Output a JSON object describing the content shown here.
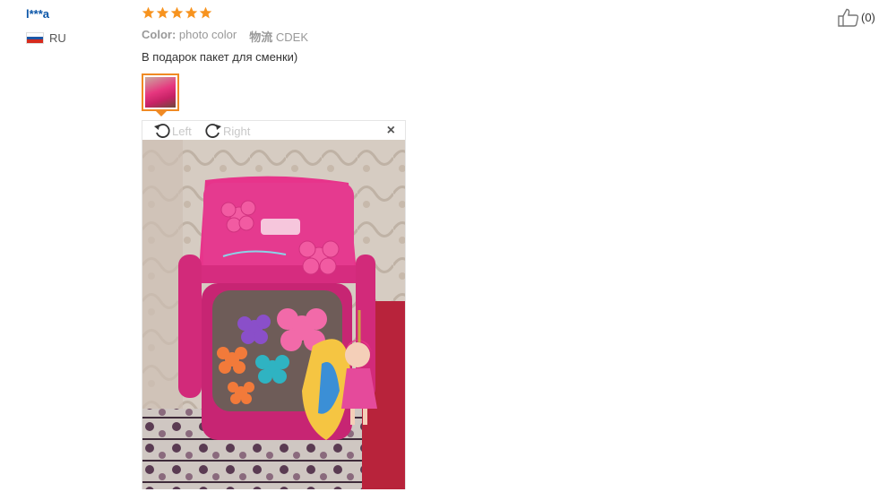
{
  "review": {
    "user_name": "l***a",
    "country": "RU",
    "rating": 5,
    "color_label": "Color:",
    "color_value": "photo color",
    "logistics_label": "物流",
    "logistics_value": "CDEK",
    "text": "В подарок пакет для сменки)",
    "like_count": "(0)"
  },
  "viewer": {
    "rotate_left_label": "Left",
    "rotate_right_label": "Right",
    "close_symbol": "×"
  },
  "colors": {
    "user_link": "#0b56a8",
    "star": "#f7931e",
    "thumb_border": "#f08a24"
  },
  "icons": {
    "flag": "russia-flag-icon",
    "star": "star-icon",
    "rotate_left": "rotate-left-icon",
    "rotate_right": "rotate-right-icon",
    "close": "close-icon",
    "like": "thumbs-up-icon"
  }
}
